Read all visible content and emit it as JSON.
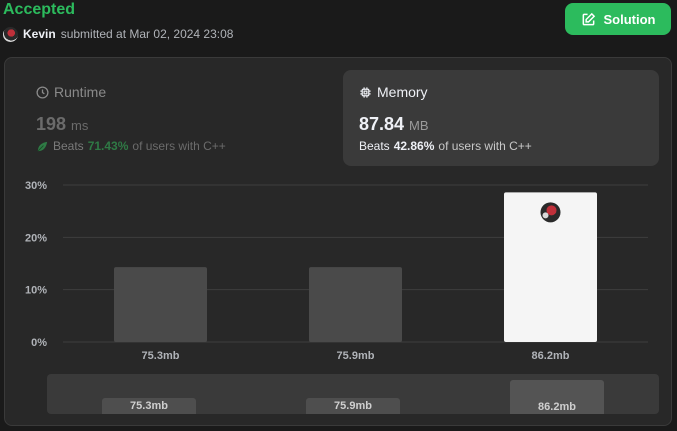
{
  "header": {
    "status": "Accepted",
    "user": "Kevin",
    "submitted_text": "submitted at Mar 02, 2024 23:08",
    "solution_label": "Solution"
  },
  "runtime": {
    "title": "Runtime",
    "value": "198",
    "unit": "ms",
    "beats_label": "Beats",
    "beats_pct": "71.43%",
    "beats_rest": "of users with C++"
  },
  "memory": {
    "title": "Memory",
    "value": "87.84",
    "unit": "MB",
    "beats_label": "Beats",
    "beats_pct": "42.86%",
    "beats_rest": "of users with C++"
  },
  "chart_data": {
    "type": "bar",
    "categories": [
      "75.3mb",
      "75.9mb",
      "86.2mb"
    ],
    "values": [
      14.3,
      14.3,
      28.6
    ],
    "highlight_index": 2,
    "yticks": [
      "0%",
      "10%",
      "20%",
      "30%"
    ],
    "ylim": [
      0,
      30
    ],
    "grid": true,
    "colors": {
      "bar": "#4a4a4a",
      "highlight": "#f5f5f5"
    }
  },
  "navigator": {
    "labels": [
      "75.3mb",
      "75.9mb",
      "86.2mb"
    ]
  }
}
